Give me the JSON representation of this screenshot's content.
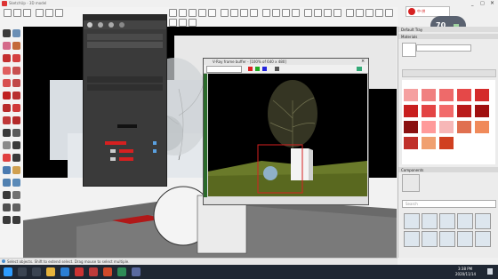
{
  "window": {
    "title": "SketchUp - 3D model"
  },
  "status": {
    "text": "Select objects. Shift to extend select. Drag mouse to select multiple."
  },
  "render_window": {
    "title": "V-Ray frame buffer - [100% of 640 x 480]"
  },
  "right_panel": {
    "header": "Default Tray",
    "section1": "Materials",
    "section2": "Components"
  },
  "search": {
    "placeholder": "Search"
  },
  "badge": {
    "value": "70"
  },
  "clock": {
    "time": "3:38 PM",
    "date": "2020/11/14"
  },
  "colors": {
    "swatches": [
      "#f5a0a0",
      "#f08080",
      "#ee6a6a",
      "#e54848",
      "#d42a2a",
      "#c81e1e",
      "#e34444",
      "#f26a6a",
      "#b91a1a",
      "#a01010",
      "#8a1010",
      "#ff9a9a",
      "#f7b7b7",
      "#e07050",
      "#f08a5a",
      "#f0a070",
      "#c0302a",
      "#d04020"
    ],
    "viewport_bg": "#000000",
    "ground": "#6a7a2a",
    "panel_bg": "#3a3a3a",
    "taskbar": "#1f2733",
    "accent_red": "#d62020"
  }
}
